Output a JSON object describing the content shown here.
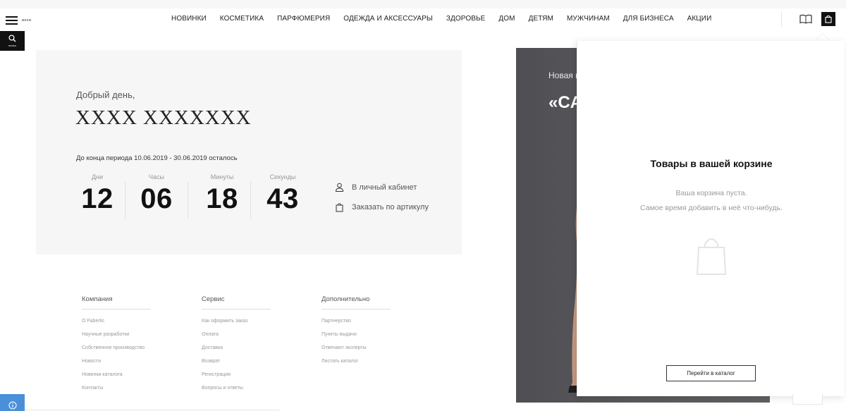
{
  "header": {
    "menu_label": "меню",
    "search_label": "поиск",
    "nav": [
      "НОВИНКИ",
      "КОСМЕТИКА",
      "ПАРФЮМЕРИЯ",
      "ОДЕЖДА И АКСЕССУАРЫ",
      "ЗДОРОВЬЕ",
      "ДОМ",
      "ДЕТЯМ",
      "МУЖЧИНАМ",
      "ДЛЯ БИЗНЕСА",
      "АКЦИИ"
    ]
  },
  "greeting": {
    "hello": "Добрый день,",
    "name": "XXXX XXXXXXX",
    "period": "До конца периода 10.06.2019 - 30.06.2019 осталось",
    "countdown": [
      {
        "label": "Дни",
        "value": "12"
      },
      {
        "label": "Часы",
        "value": "06"
      },
      {
        "label": "Минуты",
        "value": "18"
      },
      {
        "label": "Секунды",
        "value": "43"
      }
    ],
    "cabinet_link": "В личный кабинет",
    "order_link": "Заказать по артикулу"
  },
  "footer": {
    "columns": [
      {
        "title": "Компания",
        "items": [
          "О Faberlic",
          "Научные разработки",
          "Собственное производство",
          "Новости",
          "Новинки каталога",
          "Контакты"
        ]
      },
      {
        "title": "Сервис",
        "items": [
          "Как оформить заказ",
          "Оплата",
          "Доставка",
          "Возврат",
          "Регистрация",
          "Вопросы и ответы"
        ]
      },
      {
        "title": "Дополнительно",
        "items": [
          "Партнерство",
          "Пункты выдачи",
          "Отвечают эксперты",
          "Листать каталог"
        ]
      }
    ]
  },
  "banner": {
    "subtitle": "Новая к",
    "title": "«CA"
  },
  "cart": {
    "title": "Товары в вашей корзине",
    "empty_line1": "Ваша корзина пуста.",
    "empty_line2": "Самое время добавить в неё что-нибудь.",
    "button": "Перейти в каталог"
  }
}
